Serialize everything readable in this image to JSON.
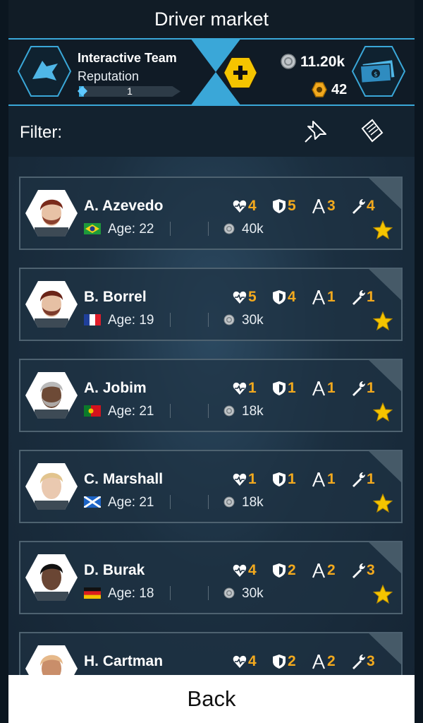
{
  "title": "Driver market",
  "team": {
    "name": "Interactive Team",
    "reputation_label": "Reputation",
    "reputation_level": "1",
    "reputation_progress": 0.05
  },
  "currency": {
    "silver": "11.20k",
    "gold": "42"
  },
  "filter": {
    "label": "Filter:"
  },
  "accent_color": "#3aa7d8",
  "stat_color": "#f2a91e",
  "drivers": [
    {
      "name": "A. Azevedo",
      "age_text": "Age: 22",
      "cost": "40k",
      "nation": "brazil",
      "stats": {
        "health": "4",
        "defense": "5",
        "skill": "3",
        "speed": "4"
      },
      "hair": "#7a2a1a",
      "skin": "#e8c2a6",
      "beard": true
    },
    {
      "name": "B. Borrel",
      "age_text": "Age: 19",
      "cost": "30k",
      "nation": "france",
      "stats": {
        "health": "5",
        "defense": "4",
        "skill": "1",
        "speed": "1"
      },
      "hair": "#6a2418",
      "skin": "#e6c0a4",
      "beard": true
    },
    {
      "name": "A. Jobim",
      "age_text": "Age: 21",
      "cost": "18k",
      "nation": "portugal",
      "stats": {
        "health": "1",
        "defense": "1",
        "skill": "1",
        "speed": "1"
      },
      "hair": "#b9b9b9",
      "skin": "#6d4a36",
      "beard": true
    },
    {
      "name": "C. Marshall",
      "age_text": "Age: 21",
      "cost": "18k",
      "nation": "scotland",
      "stats": {
        "health": "1",
        "defense": "1",
        "skill": "1",
        "speed": "1"
      },
      "hair": "#e2c48e",
      "skin": "#eac9b0",
      "beard": false
    },
    {
      "name": "D. Burak",
      "age_text": "Age: 18",
      "cost": "30k",
      "nation": "germany",
      "stats": {
        "health": "4",
        "defense": "2",
        "skill": "2",
        "speed": "3"
      },
      "hair": "#111111",
      "skin": "#6a4634",
      "beard": false
    },
    {
      "name": "H. Cartman",
      "age_text": "",
      "cost": "",
      "nation": "",
      "stats": {
        "health": "4",
        "defense": "2",
        "skill": "2",
        "speed": "3"
      },
      "hair": "#e6b98a",
      "skin": "#c98e6a",
      "beard": false
    }
  ],
  "back_label": "Back"
}
